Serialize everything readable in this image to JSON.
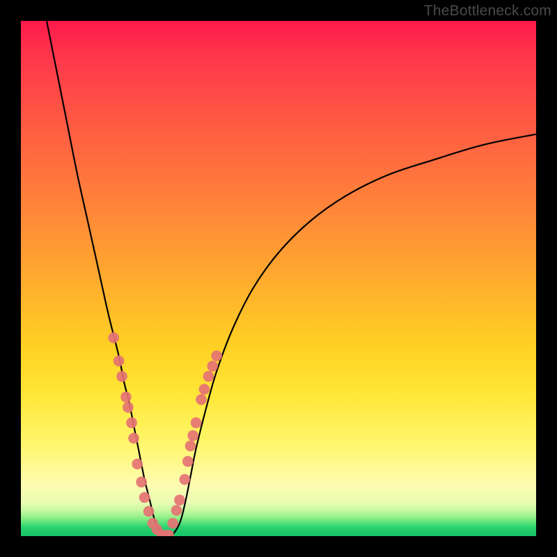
{
  "watermark": "TheBottleneck.com",
  "chart_data": {
    "type": "line",
    "title": "",
    "xlabel": "",
    "ylabel": "",
    "xlim": [
      0,
      100
    ],
    "ylim": [
      0,
      100
    ],
    "description": "V-shaped bottleneck curve over a vertical performance gradient (red=high bottleneck, green=no bottleneck). The curve reaches zero (best) around x≈27 and rises steeply to both sides; the right branch asymptotes near y≈78.",
    "series": [
      {
        "name": "bottleneck-curve",
        "x": [
          5,
          7,
          9,
          11,
          13,
          15,
          17,
          19,
          20,
          21,
          22,
          23,
          24,
          25,
          26,
          27,
          28,
          29,
          30,
          31,
          32,
          33,
          34,
          36,
          38,
          41,
          45,
          50,
          56,
          63,
          71,
          80,
          90,
          100
        ],
        "y": [
          100,
          90,
          80,
          70,
          61,
          52,
          43,
          35,
          30,
          26,
          21,
          16,
          11,
          7,
          3,
          1,
          0,
          0,
          1,
          3,
          7,
          12,
          17,
          25,
          32,
          40,
          48,
          55,
          61,
          66,
          70,
          73,
          76,
          78
        ]
      },
      {
        "name": "sample-dots-left",
        "x": [
          18.0,
          19.0,
          19.6,
          20.4,
          20.8,
          21.5,
          21.9,
          22.6,
          23.4,
          24.0,
          24.8,
          25.6,
          26.4
        ],
        "y": [
          38.5,
          34.0,
          31.0,
          27.0,
          25.0,
          22.0,
          19.0,
          14.0,
          10.5,
          7.5,
          4.8,
          2.5,
          1.3
        ]
      },
      {
        "name": "sample-dots-right",
        "x": [
          29.5,
          30.2,
          30.8,
          31.8,
          32.4,
          32.9,
          33.4,
          34.0,
          35.0,
          35.6,
          36.4,
          37.2,
          38.0
        ],
        "y": [
          2.5,
          5.0,
          7.0,
          11.0,
          14.5,
          17.5,
          19.5,
          22.0,
          26.5,
          28.5,
          31.0,
          33.0,
          35.0
        ]
      },
      {
        "name": "sample-dots-bottom",
        "x": [
          27.3,
          28.0,
          28.7
        ],
        "y": [
          0.3,
          0.2,
          0.3
        ]
      }
    ],
    "colors": {
      "curve": "#000000",
      "dots": "#e57373"
    }
  }
}
